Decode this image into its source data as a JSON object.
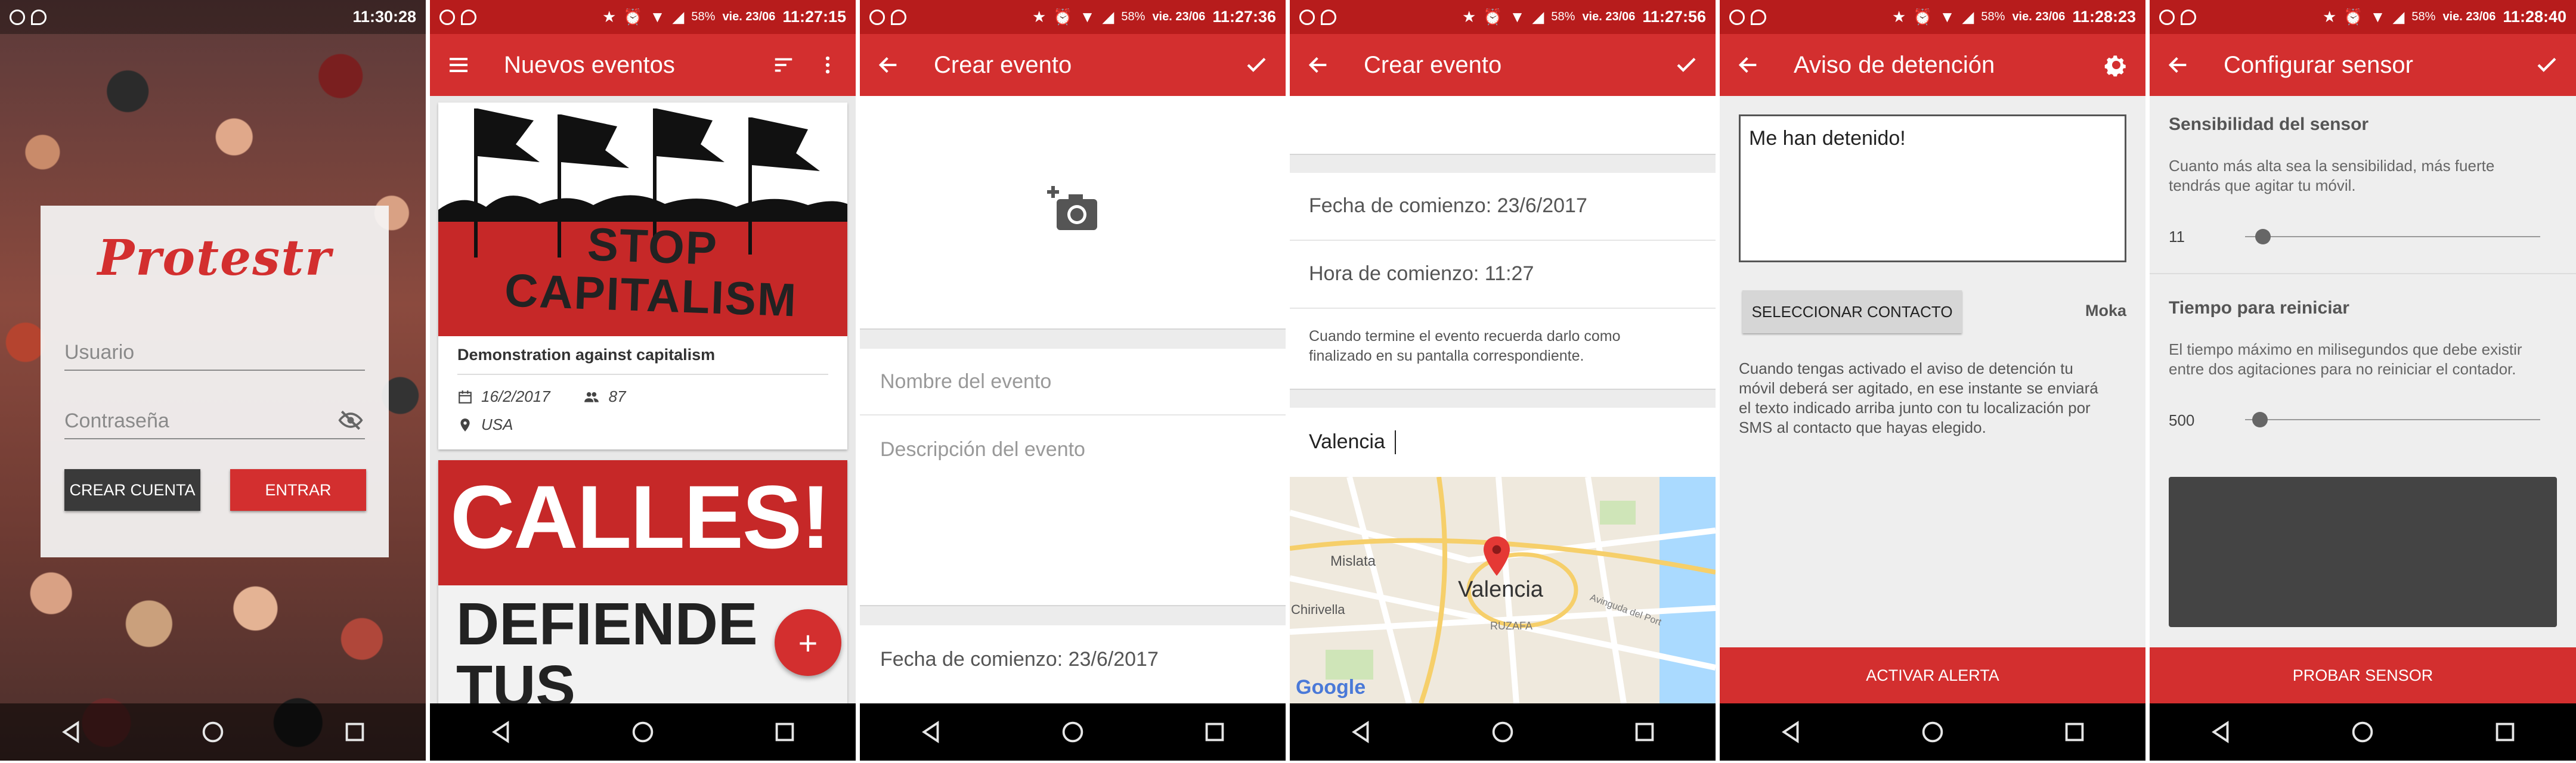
{
  "colors": {
    "accent": "#d32f2f",
    "statusbar": "#c62828",
    "nav": "#000000"
  },
  "icons": {
    "camera": "add-photo-icon",
    "map_pin": "map-marker-icon",
    "gear": "gear-icon"
  },
  "panels": [
    {
      "status": {
        "battery": "",
        "date": "vie. 23/06",
        "time": "11:30:28"
      }
    },
    {
      "status": {
        "battery": "58%",
        "date": "vie. 23/06",
        "time": "11:27:15"
      }
    },
    {
      "status": {
        "battery": "58%",
        "date": "vie. 23/06",
        "time": "11:27:36"
      }
    },
    {
      "status": {
        "battery": "58%",
        "date": "vie. 23/06",
        "time": "11:27:56"
      }
    },
    {
      "status": {
        "battery": "58%",
        "date": "vie. 23/06",
        "time": "11:28:23"
      }
    },
    {
      "status": {
        "battery": "58%",
        "date": "vie. 23/06",
        "time": "11:28:40"
      }
    }
  ],
  "login": {
    "app_name": "Protestr",
    "user_placeholder": "Usuario",
    "password_placeholder": "Contraseña",
    "create_account": "CREAR CUENTA",
    "enter": "ENTRAR"
  },
  "events": {
    "title": "Nuevos eventos",
    "cards": [
      {
        "banner_text": "STOP CAPITALISM",
        "name": "Demonstration against capitalism",
        "date": "16/2/2017",
        "attendees": "87",
        "location": "USA"
      },
      {
        "banner_line1": "CALLES!",
        "banner_line2": "DEFIENDE",
        "banner_line3": "TUS DERECHOS"
      }
    ],
    "fab": "+"
  },
  "create_event": {
    "title": "Crear evento",
    "name_placeholder": "Nombre del evento",
    "description_placeholder": "Descripción del evento",
    "start_date": "Fecha de comienzo: 23/6/2017"
  },
  "create_event2": {
    "title": "Crear evento",
    "start_date": "Fecha de comienzo: 23/6/2017",
    "start_time": "Hora de comienzo: 11:27",
    "note": "Cuando termine el evento recuerda darlo como finalizado en su pantalla correspondiente.",
    "location_value": "Valencia",
    "map_city": "Valencia",
    "map_labels": [
      "Mislata",
      "Chirivella",
      "RUZAFA",
      "Avinguda del Port"
    ],
    "map_brand": "Google"
  },
  "arrest": {
    "title": "Aviso de detención",
    "message": "Me han detenido!",
    "select_contact": "SELECCIONAR CONTACTO",
    "contact_name": "Moka",
    "description": "Cuando tengas activado el aviso de detención tu móvil deberá ser agitado, en ese instante se enviará el texto indicado arriba junto con tu localización por SMS al contacto que hayas elegido.",
    "activate": "ACTIVAR ALERTA"
  },
  "sensor": {
    "title": "Configurar sensor",
    "sensitivity_title": "Sensibilidad del sensor",
    "sensitivity_desc": "Cuanto más alta sea la sensibilidad, más fuerte tendrás que agitar tu móvil.",
    "sensitivity_value": "11",
    "sensitivity_fraction": 0.06,
    "reset_title": "Tiempo para reiniciar",
    "reset_desc": "El tiempo máximo en milisegundos que debe existir entre dos agitaciones para no reiniciar el contador.",
    "reset_value": "500",
    "reset_fraction": 0.05,
    "test": "PROBAR SENSOR"
  }
}
